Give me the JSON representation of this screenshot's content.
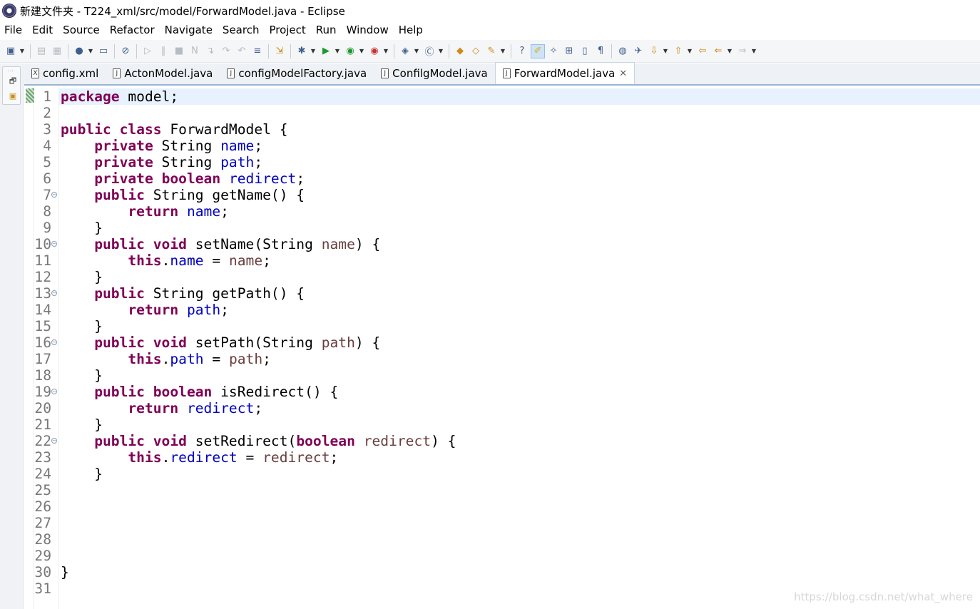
{
  "window": {
    "title": "新建文件夹 - T224_xml/src/model/ForwardModel.java - Eclipse"
  },
  "menu": [
    "File",
    "Edit",
    "Source",
    "Refactor",
    "Navigate",
    "Search",
    "Project",
    "Run",
    "Window",
    "Help"
  ],
  "toolbar": {
    "buttons": [
      {
        "name": "new-icon",
        "glyph": "▣",
        "dropdown": true
      },
      {
        "name": "save-icon",
        "glyph": "▤",
        "state": "disabled"
      },
      {
        "name": "save-all-icon",
        "glyph": "▦",
        "state": "disabled"
      },
      {
        "name": "profile-icon",
        "glyph": "●",
        "dropdown": true
      },
      {
        "name": "terminal-icon",
        "glyph": "▭"
      },
      {
        "name": "skip-breakpoints-icon",
        "glyph": "⊘"
      },
      {
        "name": "resume-icon",
        "glyph": "▷",
        "state": "disabled"
      },
      {
        "name": "suspend-icon",
        "glyph": "‖",
        "state": "disabled"
      },
      {
        "name": "terminate-icon",
        "glyph": "■",
        "state": "disabled"
      },
      {
        "name": "disconnect-icon",
        "glyph": "N",
        "state": "disabled"
      },
      {
        "name": "step-into-icon",
        "glyph": "↴",
        "state": "disabled"
      },
      {
        "name": "step-over-icon",
        "glyph": "↷",
        "state": "disabled"
      },
      {
        "name": "step-return-icon",
        "glyph": "↶",
        "state": "disabled"
      },
      {
        "name": "drop-to-frame-icon",
        "glyph": "≡"
      },
      {
        "name": "use-step-filters-icon",
        "glyph": "⇲",
        "color": "orange"
      },
      {
        "name": "debug-icon",
        "glyph": "✱",
        "dropdown": true
      },
      {
        "name": "run-icon",
        "glyph": "▶",
        "color": "green",
        "dropdown": true
      },
      {
        "name": "coverage-icon",
        "glyph": "◉",
        "color": "green",
        "dropdown": true
      },
      {
        "name": "external-tools-icon",
        "glyph": "◉",
        "color": "red",
        "dropdown": true
      },
      {
        "name": "new-java-project-icon",
        "glyph": "◈",
        "dropdown": true
      },
      {
        "name": "new-java-class-icon",
        "glyph": "Ⓒ",
        "dropdown": true
      },
      {
        "name": "open-type-icon",
        "glyph": "◆",
        "color": "orange"
      },
      {
        "name": "open-task-icon",
        "glyph": "◇",
        "color": "orange"
      },
      {
        "name": "search-icon",
        "glyph": "✎",
        "color": "orange",
        "dropdown": true
      },
      {
        "name": "toggle-ant-icon",
        "glyph": "?"
      },
      {
        "name": "toggle-mark-occurrences-icon",
        "glyph": "✐",
        "color": "yellow",
        "state": "active"
      },
      {
        "name": "toggle-breadcrumb-icon",
        "glyph": "✧"
      },
      {
        "name": "toggle-block-selection-icon",
        "glyph": "⊞"
      },
      {
        "name": "show-whitespace-icon",
        "glyph": "▯"
      },
      {
        "name": "show-paragraph-icon",
        "glyph": "¶"
      },
      {
        "name": "globe-icon",
        "glyph": "◍"
      },
      {
        "name": "annotation-icon",
        "glyph": "✈"
      },
      {
        "name": "next-annotation-icon",
        "glyph": "⇩",
        "color": "orange",
        "dropdown": true
      },
      {
        "name": "prev-annotation-icon",
        "glyph": "⇧",
        "color": "orange",
        "dropdown": true
      },
      {
        "name": "last-edit-icon",
        "glyph": "⇦",
        "color": "orange"
      },
      {
        "name": "back-icon",
        "glyph": "⇐",
        "color": "orange",
        "dropdown": true
      },
      {
        "name": "forward-icon",
        "glyph": "⇒",
        "state": "disabled",
        "dropdown": true
      }
    ]
  },
  "tabs": [
    {
      "label": "config.xml",
      "icon": "X",
      "active": false
    },
    {
      "label": "ActonModel.java",
      "icon": "J",
      "active": false
    },
    {
      "label": "configModelFactory.java",
      "icon": "J",
      "active": false
    },
    {
      "label": "ConfilgModel.java",
      "icon": "J",
      "active": false
    },
    {
      "label": "ForwardModel.java",
      "icon": "J",
      "active": true,
      "close": "✕"
    }
  ],
  "editor": {
    "current_line": 1,
    "lines": [
      {
        "n": "1",
        "tokens": [
          [
            "kw",
            "package"
          ],
          [
            "txt",
            " model;"
          ]
        ]
      },
      {
        "n": "2",
        "tokens": []
      },
      {
        "n": "3",
        "tokens": [
          [
            "kw",
            "public"
          ],
          [
            "txt",
            " "
          ],
          [
            "kw",
            "class"
          ],
          [
            "txt",
            " ForwardModel {"
          ]
        ]
      },
      {
        "n": "4",
        "tokens": [
          [
            "txt",
            "    "
          ],
          [
            "kw",
            "private"
          ],
          [
            "txt",
            " String "
          ],
          [
            "fld",
            "name"
          ],
          [
            "txt",
            ";"
          ]
        ]
      },
      {
        "n": "5",
        "tokens": [
          [
            "txt",
            "    "
          ],
          [
            "kw",
            "private"
          ],
          [
            "txt",
            " String "
          ],
          [
            "fld",
            "path"
          ],
          [
            "txt",
            ";"
          ]
        ]
      },
      {
        "n": "6",
        "tokens": [
          [
            "txt",
            "    "
          ],
          [
            "kw",
            "private"
          ],
          [
            "txt",
            " "
          ],
          [
            "kw",
            "boolean"
          ],
          [
            "txt",
            " "
          ],
          [
            "fld",
            "redirect"
          ],
          [
            "txt",
            ";"
          ]
        ]
      },
      {
        "n": "7",
        "fold": true,
        "tokens": [
          [
            "txt",
            "    "
          ],
          [
            "kw",
            "public"
          ],
          [
            "txt",
            " String getName() {"
          ]
        ]
      },
      {
        "n": "8",
        "tokens": [
          [
            "txt",
            "        "
          ],
          [
            "kw",
            "return"
          ],
          [
            "txt",
            " "
          ],
          [
            "fld",
            "name"
          ],
          [
            "txt",
            ";"
          ]
        ]
      },
      {
        "n": "9",
        "tokens": [
          [
            "txt",
            "    }"
          ]
        ]
      },
      {
        "n": "10",
        "fold": true,
        "tokens": [
          [
            "txt",
            "    "
          ],
          [
            "kw",
            "public"
          ],
          [
            "txt",
            " "
          ],
          [
            "kw",
            "void"
          ],
          [
            "txt",
            " setName(String "
          ],
          [
            "prm",
            "name"
          ],
          [
            "txt",
            ") {"
          ]
        ]
      },
      {
        "n": "11",
        "tokens": [
          [
            "txt",
            "        "
          ],
          [
            "kw",
            "this"
          ],
          [
            "txt",
            "."
          ],
          [
            "fld",
            "name"
          ],
          [
            "txt",
            " = "
          ],
          [
            "prm",
            "name"
          ],
          [
            "txt",
            ";"
          ]
        ]
      },
      {
        "n": "12",
        "tokens": [
          [
            "txt",
            "    }"
          ]
        ]
      },
      {
        "n": "13",
        "fold": true,
        "tokens": [
          [
            "txt",
            "    "
          ],
          [
            "kw",
            "public"
          ],
          [
            "txt",
            " String getPath() {"
          ]
        ]
      },
      {
        "n": "14",
        "tokens": [
          [
            "txt",
            "        "
          ],
          [
            "kw",
            "return"
          ],
          [
            "txt",
            " "
          ],
          [
            "fld",
            "path"
          ],
          [
            "txt",
            ";"
          ]
        ]
      },
      {
        "n": "15",
        "tokens": [
          [
            "txt",
            "    }"
          ]
        ]
      },
      {
        "n": "16",
        "fold": true,
        "tokens": [
          [
            "txt",
            "    "
          ],
          [
            "kw",
            "public"
          ],
          [
            "txt",
            " "
          ],
          [
            "kw",
            "void"
          ],
          [
            "txt",
            " setPath(String "
          ],
          [
            "prm",
            "path"
          ],
          [
            "txt",
            ") {"
          ]
        ]
      },
      {
        "n": "17",
        "tokens": [
          [
            "txt",
            "        "
          ],
          [
            "kw",
            "this"
          ],
          [
            "txt",
            "."
          ],
          [
            "fld",
            "path"
          ],
          [
            "txt",
            " = "
          ],
          [
            "prm",
            "path"
          ],
          [
            "txt",
            ";"
          ]
        ]
      },
      {
        "n": "18",
        "tokens": [
          [
            "txt",
            "    }"
          ]
        ]
      },
      {
        "n": "19",
        "fold": true,
        "tokens": [
          [
            "txt",
            "    "
          ],
          [
            "kw",
            "public"
          ],
          [
            "txt",
            " "
          ],
          [
            "kw",
            "boolean"
          ],
          [
            "txt",
            " isRedirect() {"
          ]
        ]
      },
      {
        "n": "20",
        "tokens": [
          [
            "txt",
            "        "
          ],
          [
            "kw",
            "return"
          ],
          [
            "txt",
            " "
          ],
          [
            "fld",
            "redirect"
          ],
          [
            "txt",
            ";"
          ]
        ]
      },
      {
        "n": "21",
        "tokens": [
          [
            "txt",
            "    }"
          ]
        ]
      },
      {
        "n": "22",
        "fold": true,
        "tokens": [
          [
            "txt",
            "    "
          ],
          [
            "kw",
            "public"
          ],
          [
            "txt",
            " "
          ],
          [
            "kw",
            "void"
          ],
          [
            "txt",
            " setRedirect("
          ],
          [
            "kw",
            "boolean"
          ],
          [
            "txt",
            " "
          ],
          [
            "prm",
            "redirect"
          ],
          [
            "txt",
            ") {"
          ]
        ]
      },
      {
        "n": "23",
        "tokens": [
          [
            "txt",
            "        "
          ],
          [
            "kw",
            "this"
          ],
          [
            "txt",
            "."
          ],
          [
            "fld",
            "redirect"
          ],
          [
            "txt",
            " = "
          ],
          [
            "prm",
            "redirect"
          ],
          [
            "txt",
            ";"
          ]
        ]
      },
      {
        "n": "24",
        "tokens": [
          [
            "txt",
            "    }"
          ]
        ]
      },
      {
        "n": "25",
        "tokens": []
      },
      {
        "n": "26",
        "tokens": []
      },
      {
        "n": "27",
        "tokens": []
      },
      {
        "n": "28",
        "tokens": []
      },
      {
        "n": "29",
        "tokens": []
      },
      {
        "n": "30",
        "tokens": [
          [
            "txt",
            "}"
          ]
        ]
      },
      {
        "n": "31",
        "tokens": []
      }
    ]
  },
  "watermark": "https://blog.csdn.net/what_where",
  "colors": {
    "keyword": "#7f0055",
    "field": "#0000c0",
    "parameter": "#6a3e3e",
    "current_line_bg": "#e8f2fe",
    "tab_underline": "#99b4d1"
  }
}
